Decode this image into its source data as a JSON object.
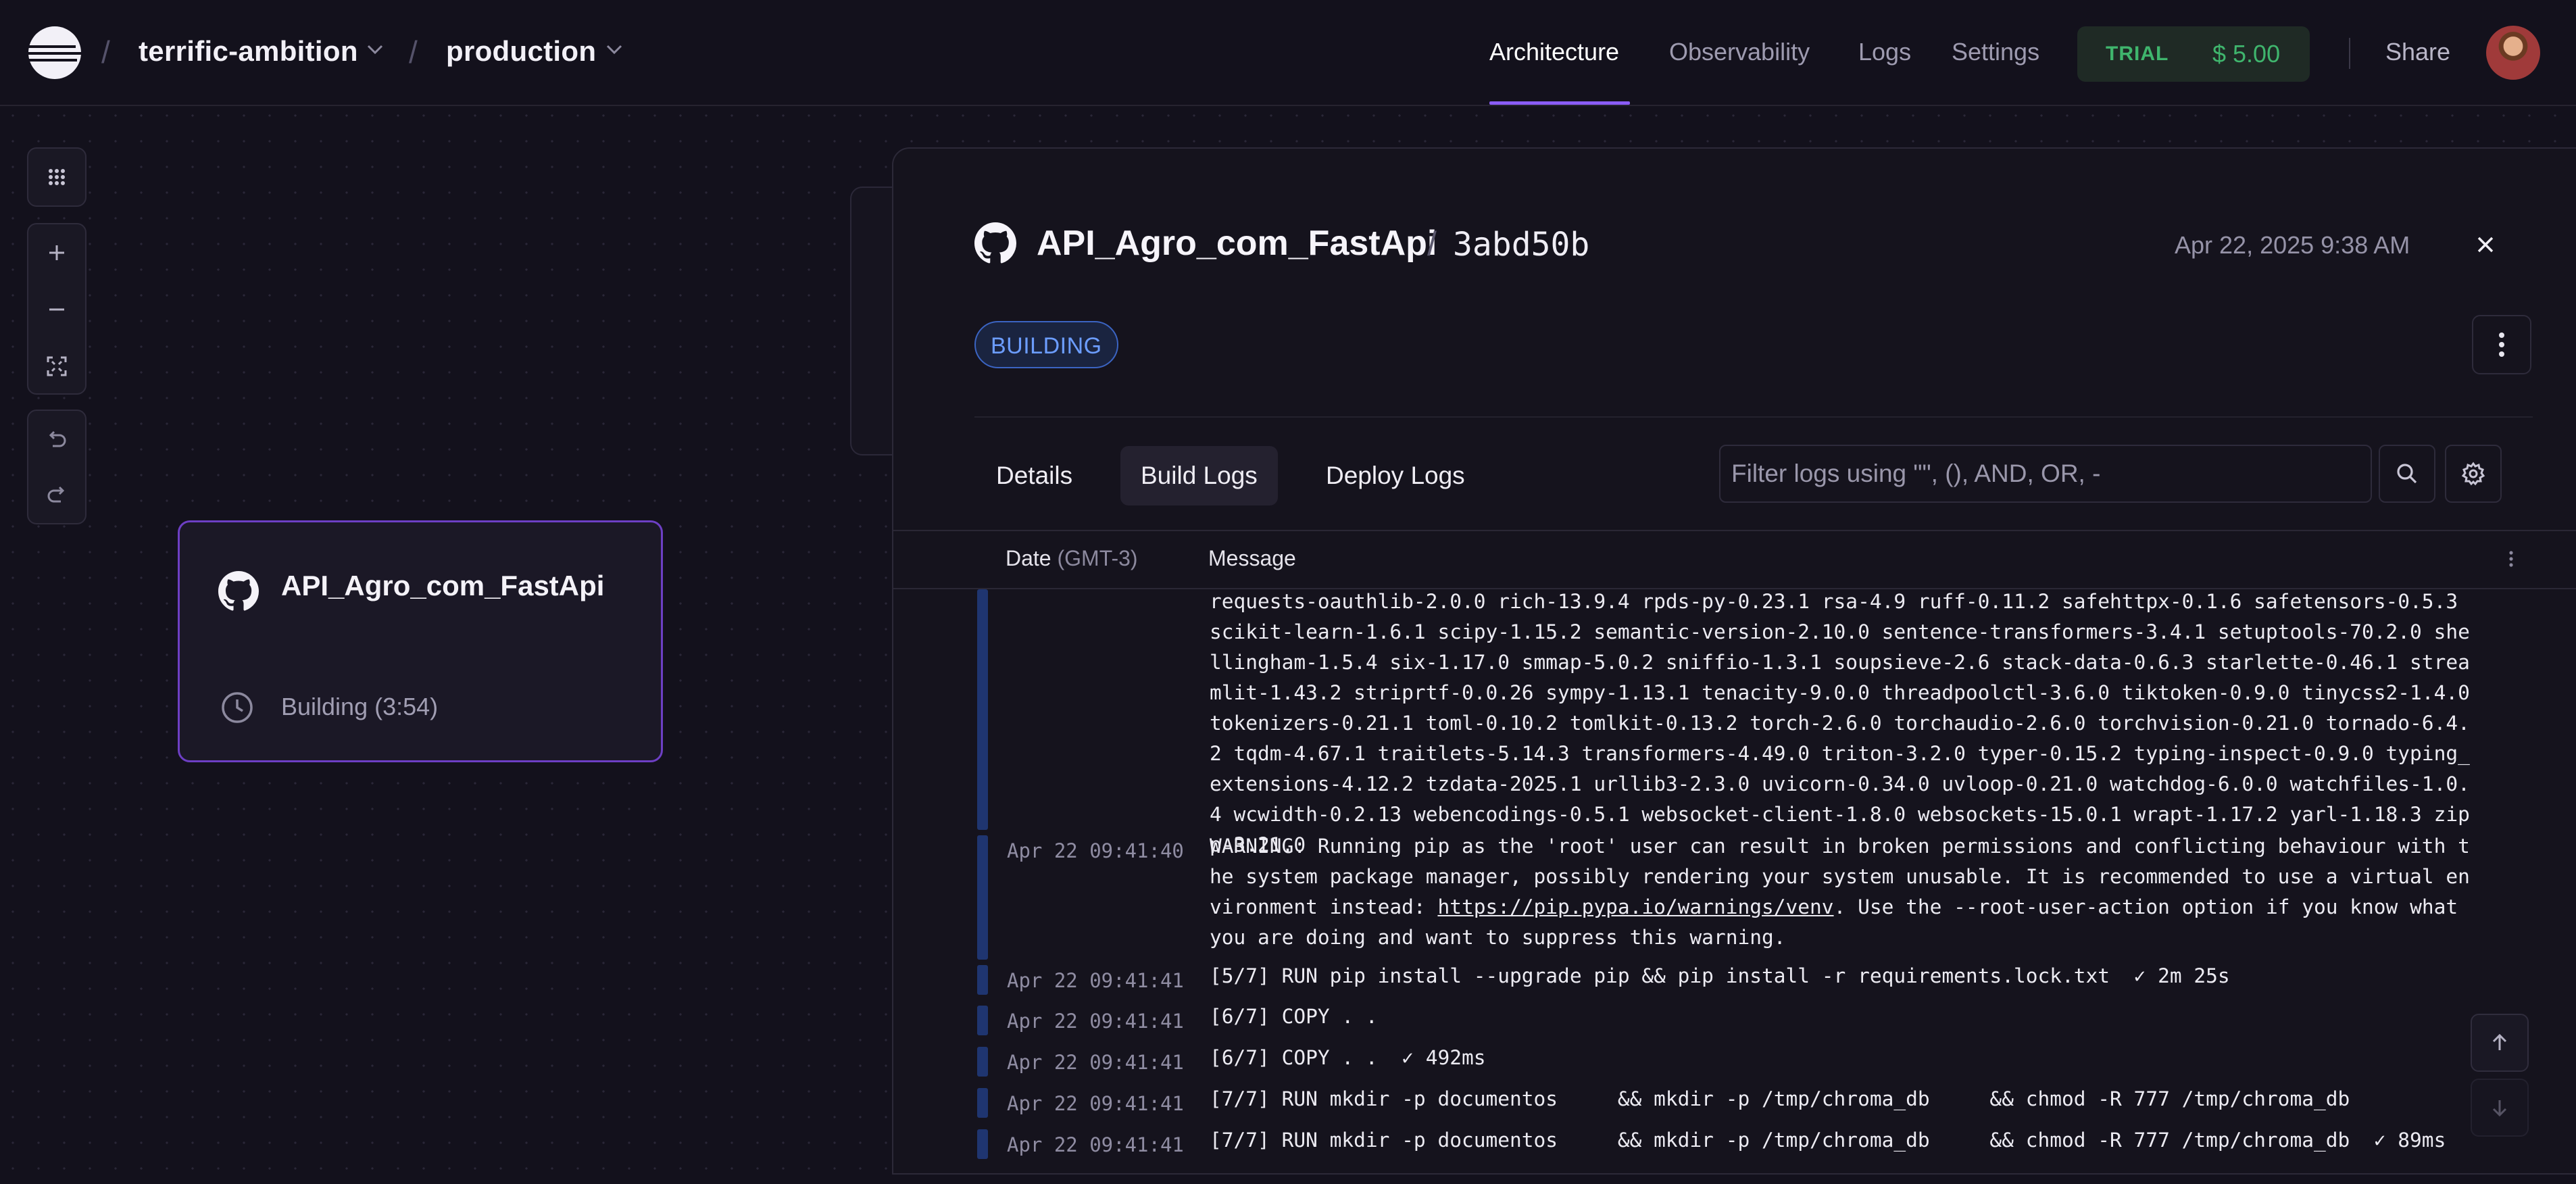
{
  "header": {
    "project": "terrific-ambition",
    "environment": "production",
    "nav": [
      "Architecture",
      "Observability",
      "Logs",
      "Settings"
    ],
    "active_nav": "Architecture",
    "trial_label": "TRIAL",
    "trial_amount": "$ 5.00",
    "share_label": "Share",
    "colors": {
      "accent": "#8a5cf5",
      "trial": "#3fb56d"
    }
  },
  "service_card": {
    "name": "API_Agro_com_FastApi",
    "status": "Building (3:54)"
  },
  "panel": {
    "repo": "API_Agro_com_FastApi",
    "commit": "3abd50b",
    "date": "Apr 22, 2025 9:38 AM",
    "badge": "BUILDING",
    "tabs": [
      "Details",
      "Build Logs",
      "Deploy Logs"
    ],
    "active_tab": "Build Logs",
    "filter_placeholder": "Filter logs using \"\", (), AND, OR, -",
    "columns": {
      "date": "Date",
      "timezone": "(GMT-3)",
      "message": "Message"
    },
    "logs": [
      {
        "date": "",
        "message": "requests-oauthlib-2.0.0 rich-13.9.4 rpds-py-0.23.1 rsa-4.9 ruff-0.11.2 safehttpx-0.1.6 safetensors-0.5.3 scikit-learn-1.6.1 scipy-1.15.2 semantic-version-2.10.0 sentence-transformers-3.4.1 setuptools-70.2.0 shellingham-1.5.4 six-1.17.0 smmap-5.0.2 sniffio-1.3.1 soupsieve-2.6 stack-data-0.6.3 starlette-0.46.1 streamlit-1.43.2 striprtf-0.0.26 sympy-1.13.1 tenacity-9.0.0 threadpoolctl-3.6.0 tiktoken-0.9.0 tinycss2-1.4.0 tokenizers-0.21.1 toml-0.10.2 tomlkit-0.13.2 torch-2.6.0 torchaudio-2.6.0 torchvision-0.21.0 tornado-6.4.2 tqdm-4.67.1 traitlets-5.14.3 transformers-4.49.0 triton-3.2.0 typer-0.15.2 typing-inspect-0.9.0 typing_extensions-4.12.2 tzdata-2025.1 urllib3-2.3.0 uvicorn-0.34.0 uvloop-0.21.0 watchdog-6.0.0 watchfiles-1.0.4 wcwidth-0.2.13 webencodings-0.5.1 websocket-client-1.8.0 websockets-15.0.1 wrapt-1.17.2 yarl-1.18.3 zipp-3.21.0"
      },
      {
        "date": "Apr 22 09:41:40",
        "message_before_link": "WARNING: Running pip as the 'root' user can result in broken permissions and conflicting behaviour with the system package manager, possibly rendering your system unusable. It is recommended to use a virtual environment instead: ",
        "link": "https://pip.pypa.io/warnings/venv",
        "message_after_link": ". Use the --root-user-action option if you know what you are doing and want to suppress this warning."
      },
      {
        "date": "Apr 22 09:41:41",
        "message": "[5/7] RUN pip install --upgrade pip && pip install -r requirements.lock.txt  ✓ 2m 25s"
      },
      {
        "date": "Apr 22 09:41:41",
        "message": "[6/7] COPY . ."
      },
      {
        "date": "Apr 22 09:41:41",
        "message": "[6/7] COPY . .  ✓ 492ms"
      },
      {
        "date": "Apr 22 09:41:41",
        "message": "[7/7] RUN mkdir -p documentos     && mkdir -p /tmp/chroma_db     && chmod -R 777 /tmp/chroma_db"
      },
      {
        "date": "Apr 22 09:41:41",
        "message": "[7/7] RUN mkdir -p documentos     && mkdir -p /tmp/chroma_db     && chmod -R 777 /tmp/chroma_db  ✓ 89ms"
      }
    ]
  },
  "icons": [
    "railway-logo-icon",
    "chevron-down-icon",
    "github-icon",
    "clock-icon",
    "grid-icon",
    "plus-icon",
    "minus-icon",
    "fit-view-icon",
    "undo-icon",
    "redo-icon",
    "close-icon",
    "kebab-icon",
    "search-icon",
    "gear-icon",
    "arrow-up-icon",
    "arrow-down-icon"
  ]
}
